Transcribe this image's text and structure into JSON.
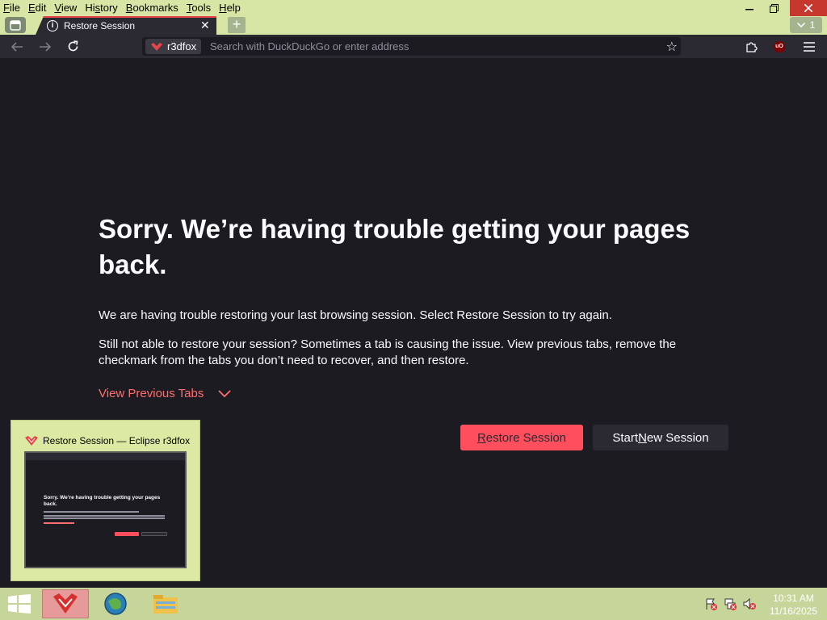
{
  "menubar": {
    "items": [
      {
        "pre": "",
        "u": "F",
        "post": "ile"
      },
      {
        "pre": "",
        "u": "E",
        "post": "dit"
      },
      {
        "pre": "",
        "u": "V",
        "post": "iew"
      },
      {
        "pre": "Hi",
        "u": "s",
        "post": "tory"
      },
      {
        "pre": "",
        "u": "B",
        "post": "ookmarks"
      },
      {
        "pre": "",
        "u": "T",
        "post": "ools"
      },
      {
        "pre": "",
        "u": "H",
        "post": "elp"
      }
    ]
  },
  "tabs": {
    "active_title": "Restore Session",
    "count": "1"
  },
  "navbar": {
    "identity_label": "r3dfox",
    "url_placeholder": "Search with DuckDuckGo or enter address",
    "ublock_badge": "uO"
  },
  "content": {
    "title": "Sorry. We’re having trouble getting your pages back.",
    "p1": "We are having trouble restoring your last browsing session. Select Restore Session to try again.",
    "p2": "Still not able to restore your session? Sometimes a tab is causing the issue. View previous tabs, remove the checkmark from the tabs you don’t need to recover, and then restore.",
    "view_previous_tabs": "View Previous Tabs",
    "restore_button": {
      "u": "R",
      "post": "estore Session"
    },
    "new_session_button": {
      "pre": "Start ",
      "u": "N",
      "post": "ew Session"
    }
  },
  "preview": {
    "title": "Restore Session — Eclipse r3dfox",
    "thumb_title": "Sorry. We’re having trouble getting your pages back."
  },
  "taskbar": {
    "time": "10:31 AM",
    "date": "11/16/2025"
  },
  "colors": {
    "accent": "#ff4f5e",
    "link": "#ff6f6f",
    "menubar_bg": "#d7e6a4",
    "content_bg": "#1c1b22",
    "toolbar_bg": "#2b2a33"
  }
}
